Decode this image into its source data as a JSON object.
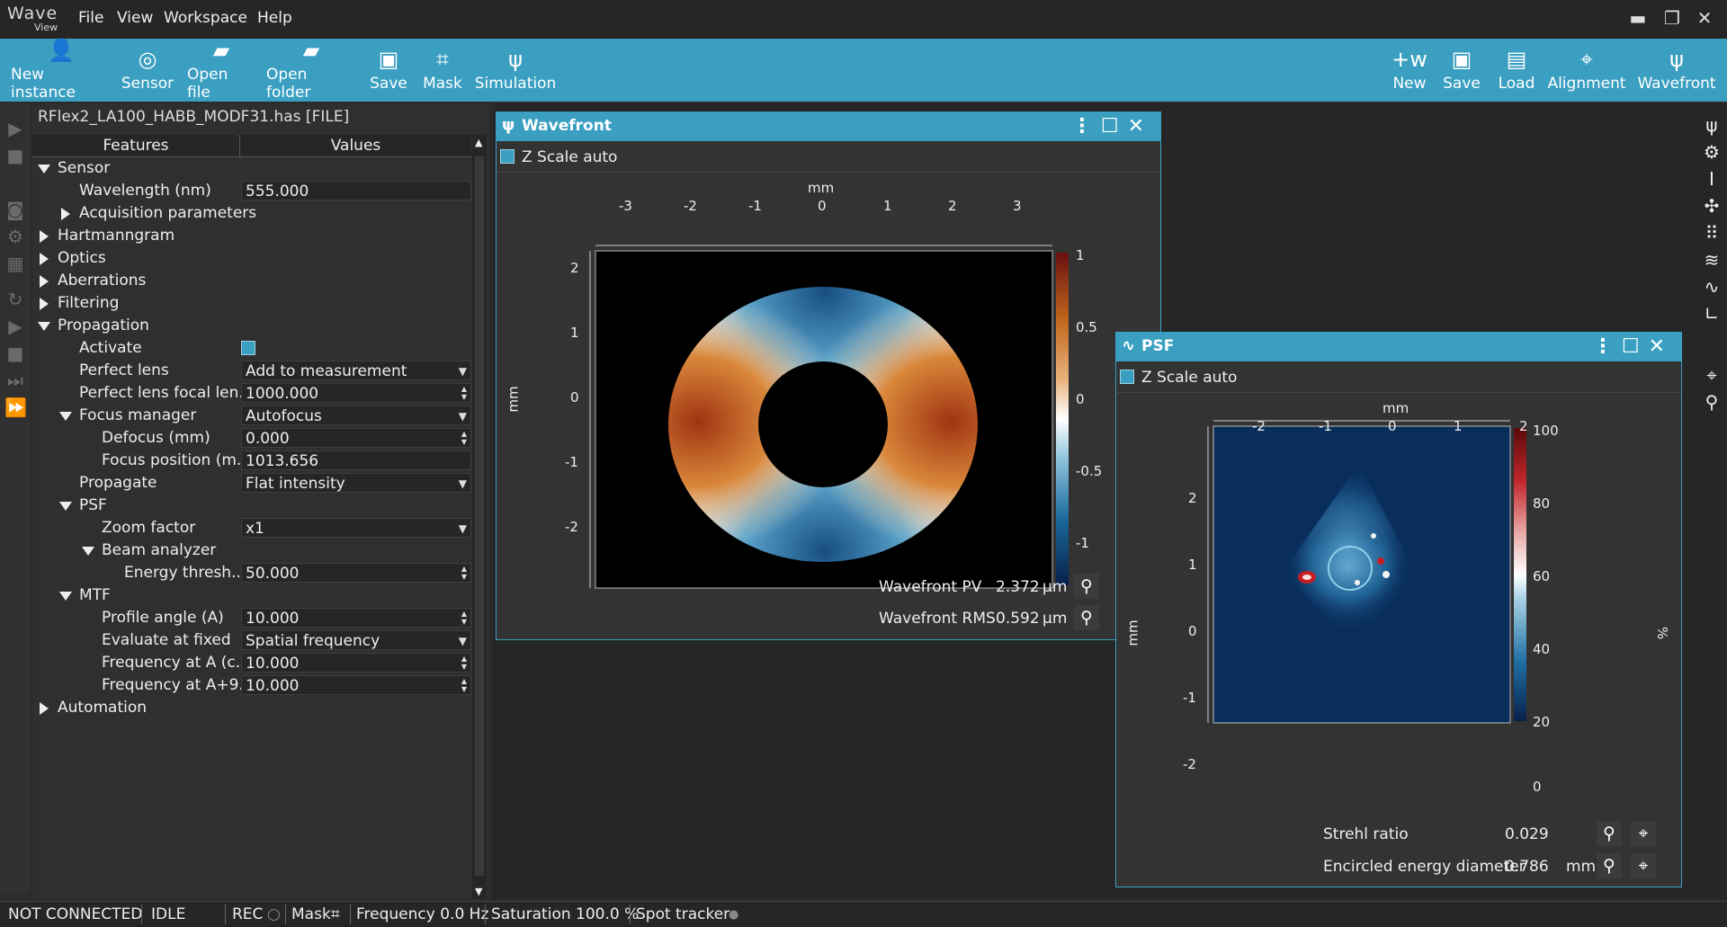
{
  "app": {
    "logo_top": "Wave",
    "logo_bottom": "View"
  },
  "menu": [
    "File",
    "View",
    "Workspace",
    "Help"
  ],
  "window_controls": {
    "minimize": "▬",
    "restore": "❐",
    "close": "✕"
  },
  "toolbar_left": [
    {
      "label": "New instance",
      "icon": "new-instance-icon"
    },
    {
      "label": "Sensor",
      "icon": "sensor-icon"
    },
    {
      "label": "Open file",
      "icon": "folder-icon"
    },
    {
      "label": "Open folder",
      "icon": "folder-icon"
    },
    {
      "label": "Save",
      "icon": "floppy-icon"
    },
    {
      "label": "Mask",
      "icon": "crop-icon"
    },
    {
      "label": "Simulation",
      "icon": "simulation-icon"
    }
  ],
  "toolbar_right": [
    {
      "label": "New",
      "icon": "new-wavefront-icon"
    },
    {
      "label": "Save",
      "icon": "floppy-icon"
    },
    {
      "label": "Load",
      "icon": "load-icon"
    },
    {
      "label": "Alignment",
      "icon": "alignment-icon"
    },
    {
      "label": "Wavefront",
      "icon": "wavefront-icon"
    }
  ],
  "file": {
    "label": "RFlex2_LA100_HABB_MODF31.has [FILE]"
  },
  "tree": {
    "header_features": "Features",
    "header_values": "Values",
    "rows": [
      {
        "label": "Sensor"
      },
      {
        "label": "Wavelength (nm)",
        "value": "555.000"
      },
      {
        "label": "Acquisition parameters"
      },
      {
        "label": "Hartmanngram"
      },
      {
        "label": "Optics"
      },
      {
        "label": "Aberrations"
      },
      {
        "label": "Filtering"
      },
      {
        "label": "Propagation"
      },
      {
        "label": "Activate",
        "checked": true
      },
      {
        "label": "Perfect lens",
        "value": "Add to measurement"
      },
      {
        "label": "Perfect lens focal len...",
        "value": "1000.000"
      },
      {
        "label": "Focus manager",
        "value": "Autofocus"
      },
      {
        "label": "Defocus (mm)",
        "value": "0.000"
      },
      {
        "label": "Focus position (m...",
        "value": "1013.656"
      },
      {
        "label": "Propagate",
        "value": "Flat intensity"
      },
      {
        "label": "PSF"
      },
      {
        "label": "Zoom factor",
        "value": "x1"
      },
      {
        "label": "Beam analyzer"
      },
      {
        "label": "Energy thresh...",
        "value": "50.000"
      },
      {
        "label": "MTF"
      },
      {
        "label": "Profile angle (A)",
        "value": "10.000"
      },
      {
        "label": "Evaluate at fixed",
        "value": "Spatial frequency"
      },
      {
        "label": "Frequency at A (c...",
        "value": "10.000"
      },
      {
        "label": "Frequency at A+9...",
        "value": "10.000"
      },
      {
        "label": "Automation"
      }
    ]
  },
  "wavefront_window": {
    "title": "Wavefront",
    "zscale": "Z Scale auto",
    "axis_unit_x": "mm",
    "axis_unit_y": "mm",
    "x_ticks": [
      "-3",
      "-2",
      "-1",
      "0",
      "1",
      "2",
      "3"
    ],
    "y_ticks": [
      "2",
      "1",
      "0",
      "-1",
      "-2"
    ],
    "colorbar_ticks": [
      "1",
      "0.5",
      "0",
      "-0.5",
      "-1"
    ],
    "pv_label": "Wavefront PV",
    "pv_value": "2.372",
    "pv_unit": "µm",
    "rms_label": "Wavefront RMS",
    "rms_value": "0.592",
    "rms_unit": "µm"
  },
  "psf_window": {
    "title": "PSF",
    "zscale": "Z Scale auto",
    "axis_unit_x": "mm",
    "axis_unit_y": "mm",
    "colorbar_unit": "%",
    "x_ticks": [
      "-2",
      "-1",
      "0",
      "1",
      "2"
    ],
    "y_ticks": [
      "2",
      "1",
      "0",
      "-1",
      "-2"
    ],
    "colorbar_ticks": [
      "100",
      "80",
      "60",
      "40",
      "20",
      "0"
    ],
    "strehl_label": "Strehl ratio",
    "strehl_value": "0.029",
    "ee_label": "Encircled energy diameter",
    "ee_value": "0.786",
    "ee_unit": "mm"
  },
  "status": {
    "connection": "NOT CONNECTED",
    "state": "IDLE",
    "rec": "REC",
    "mask": "Mask",
    "frequency": "Frequency 0.0 Hz",
    "saturation": "Saturation 100.0 %",
    "spot_tracker": "Spot tracker"
  },
  "colors": {
    "accent": "#3a9fc1",
    "background": "#262626",
    "panel": "#2f2f2f"
  }
}
